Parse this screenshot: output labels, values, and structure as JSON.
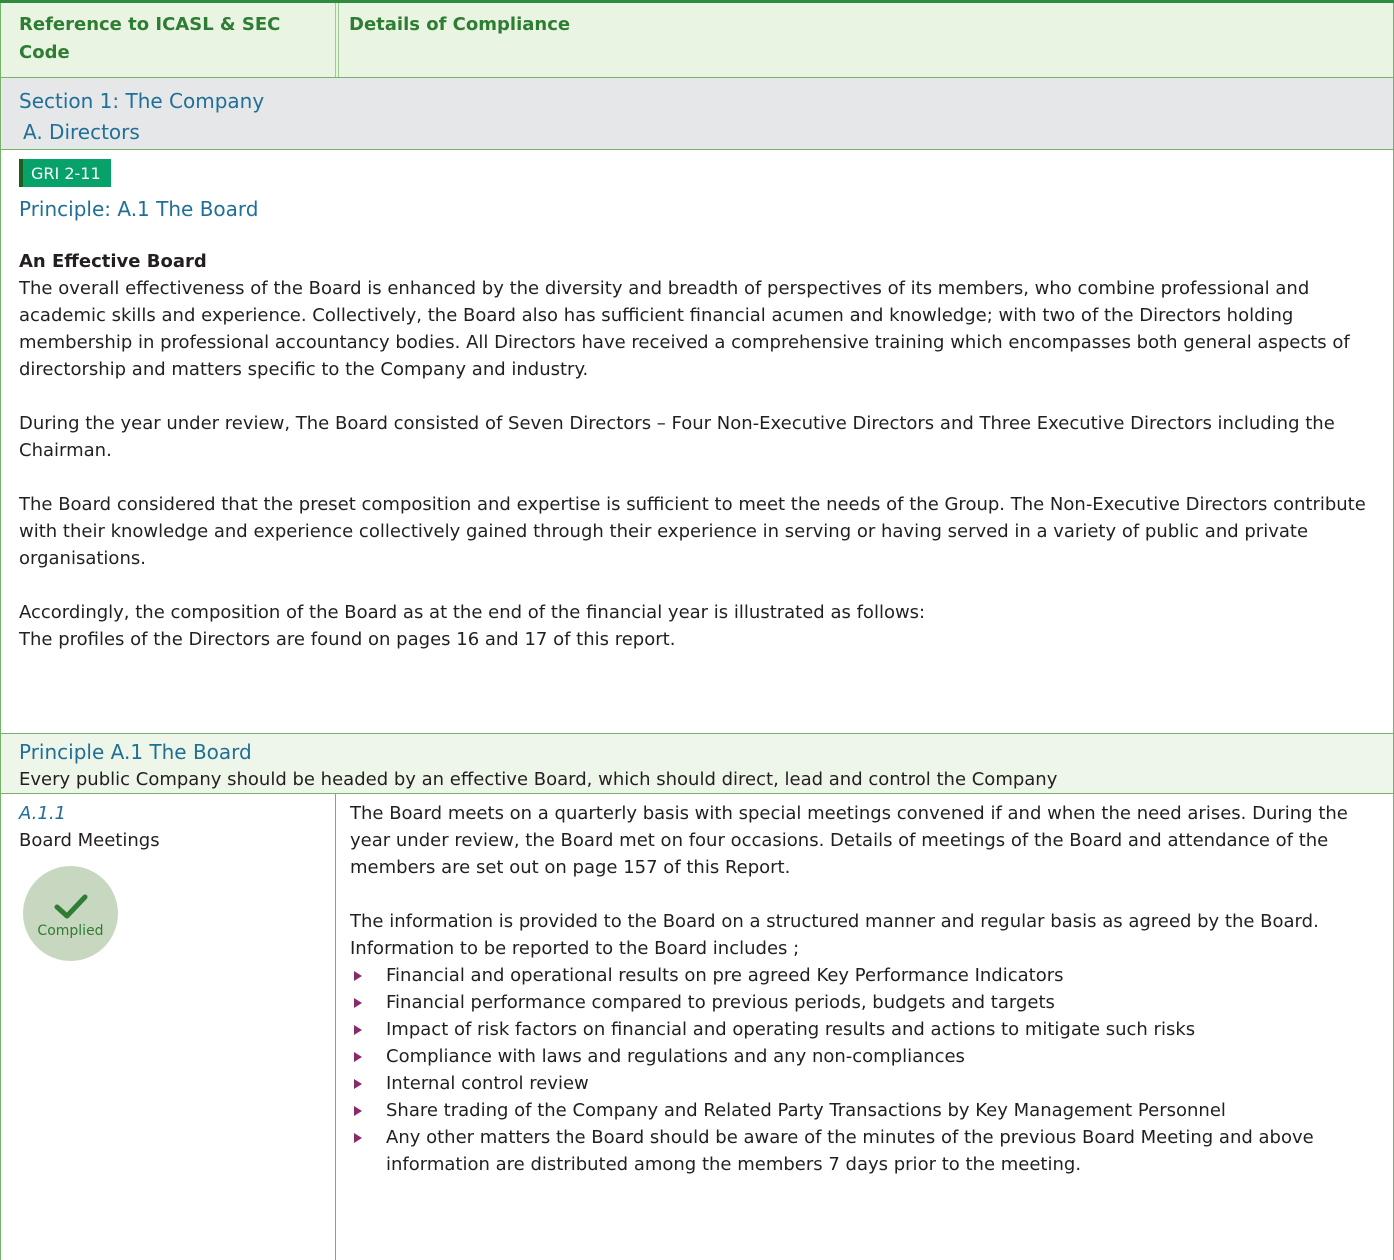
{
  "header": {
    "ref_col": "Reference to ICASL & SEC Code",
    "details_col": "Details of Compliance"
  },
  "section": {
    "title": "Section 1: The Company",
    "subtitle": "A. Directors"
  },
  "gri_badge": "GRI 2-11",
  "principle_heading": "Principle: A.1 The Board",
  "effective_board": {
    "heading": "An Effective Board",
    "paragraphs": [
      "The overall effectiveness of the Board is enhanced by the diversity and breadth of perspectives of its members, who combine professional and academic skills and experience. Collectively, the Board also has sufficient financial acumen and knowledge; with two of the Directors holding membership in professional accountancy bodies. All Directors have received a comprehensive training which encompasses both general aspects of directorship and matters specific to the Company and industry.",
      "During the year under review, The Board consisted of Seven Directors – Four Non-Executive Directors and Three Executive Directors including the Chairman.",
      "The Board considered that the preset composition and expertise is sufficient to meet the needs of the Group. The Non-Executive Directors contribute with their knowledge and experience collectively gained through their experience in serving or having served in a variety of public and private organisations."
    ],
    "closing_line_1": "Accordingly, the composition of the Board as at the end of the financial year is illustrated as follows:",
    "closing_line_2": "The profiles of the Directors are found on pages 16 and 17 of this report."
  },
  "principle_band": {
    "title": "Principle A.1 The Board",
    "text": "Every public Company should be headed by an effective Board, which should direct, lead and control the Company"
  },
  "row_a11": {
    "code": "A.1.1",
    "label": "Board Meetings",
    "status": "Complied",
    "para_1": "The Board meets on a quarterly basis with special meetings convened if and when the need arises. During the year under review, the Board met on four occasions. Details of meetings of the Board and attendance of the members are set out on page 157 of this Report.",
    "para_2": "The information is provided to the Board on a structured manner and regular basis as agreed by the Board.",
    "para_3": "Information to be reported to the Board includes ;",
    "bullets": [
      "Financial and operational results on pre agreed Key Performance Indicators",
      "Financial performance compared to previous periods, budgets and targets",
      "Impact of risk factors on financial and operating results and actions to mitigate such risks",
      "Compliance with laws and regulations and any non-compliances",
      "Internal control review",
      "Share trading of the Company and Related Party Transactions by Key Management Personnel",
      "Any other matters the Board should be aware of the minutes of the previous Board Meeting and above information are distributed among the members 7 days prior to the meeting."
    ]
  },
  "colors": {
    "green_rule": "#2f8a41",
    "heading_blue": "#1f6f97",
    "badge_green": "#07a26a",
    "bullet_arrow": "#8b2a6b"
  }
}
